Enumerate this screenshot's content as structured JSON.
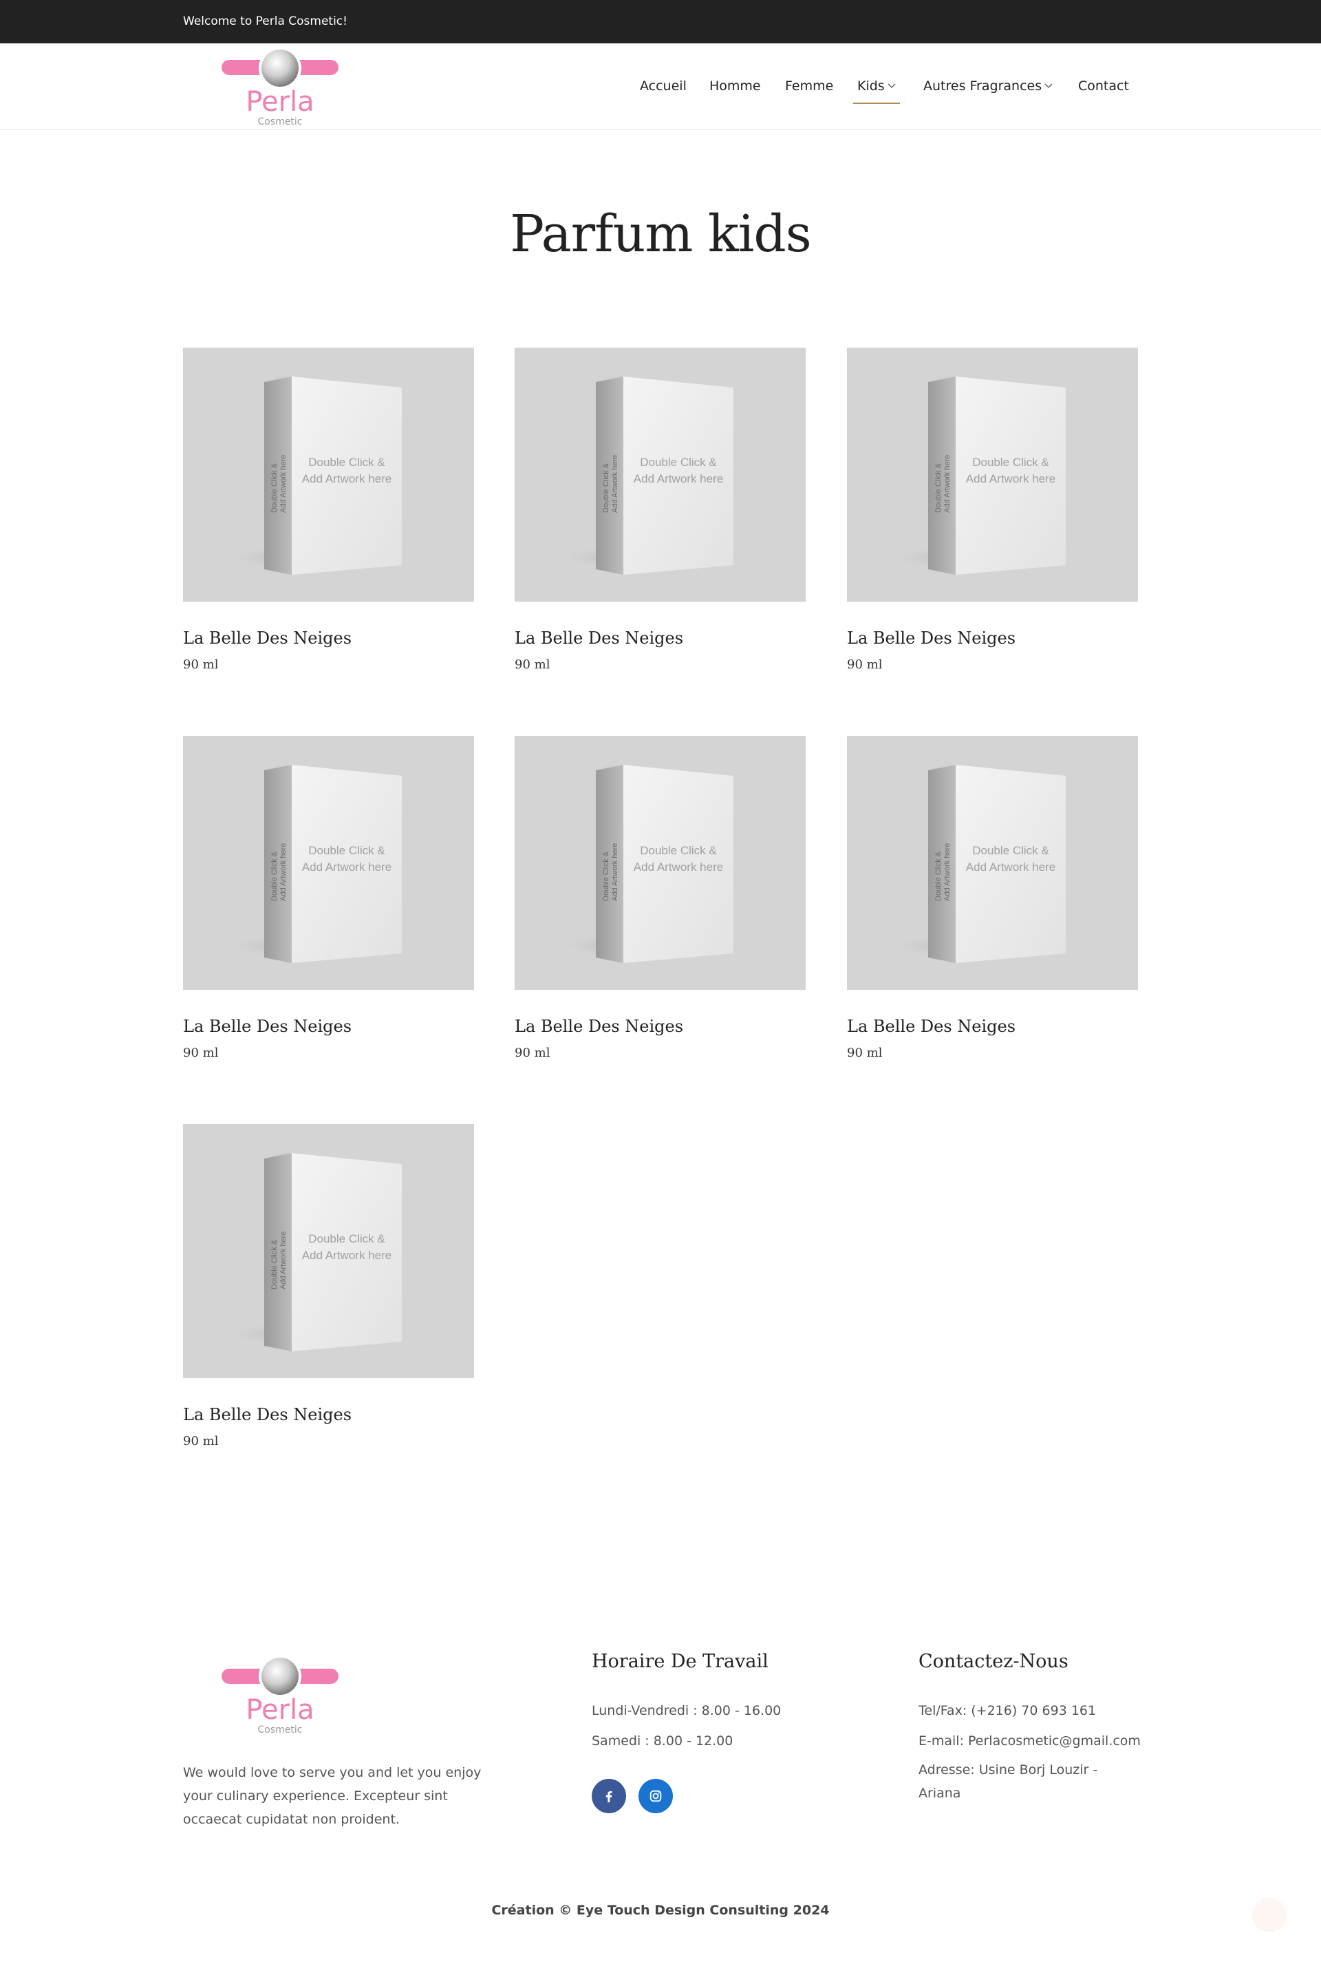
{
  "topbar": {
    "welcome": "Welcome to Perla Cosmetic!"
  },
  "brand": {
    "name": "Perla",
    "tagline": "Cosmetic",
    "accent": "#f07fb0"
  },
  "nav": {
    "items": [
      {
        "label": "Accueil",
        "has_dropdown": false,
        "active": false
      },
      {
        "label": "Homme",
        "has_dropdown": false,
        "active": false
      },
      {
        "label": "Femme",
        "has_dropdown": false,
        "active": false
      },
      {
        "label": "Kids",
        "has_dropdown": true,
        "active": true
      },
      {
        "label": "Autres Fragrances",
        "has_dropdown": true,
        "active": false
      },
      {
        "label": "Contact",
        "has_dropdown": false,
        "active": false
      }
    ],
    "active_color": "#b08d57"
  },
  "page": {
    "title": "Parfum kids"
  },
  "products": [
    {
      "name": "La Belle Des Neiges",
      "size": "90 ml"
    },
    {
      "name": "La Belle Des Neiges",
      "size": "90 ml"
    },
    {
      "name": "La Belle Des Neiges",
      "size": "90 ml"
    },
    {
      "name": "La Belle Des Neiges",
      "size": "90 ml"
    },
    {
      "name": "La Belle Des Neiges",
      "size": "90 ml"
    },
    {
      "name": "La Belle Des Neiges",
      "size": "90 ml"
    },
    {
      "name": "La Belle Des Neiges",
      "size": "90 ml"
    }
  ],
  "mockup": {
    "front_line1": "Double Click &",
    "front_line2": "Add Artwork here",
    "side_line1": "Double Click &",
    "side_line2": "Add Artwork here"
  },
  "footer": {
    "about": "We would love to serve you and let you enjoy your culinary experience. Excepteur sint occaecat cupidatat non proident.",
    "hours": {
      "title": "Horaire De Travail",
      "lines": [
        "Lundi-Vendredi : 8.00 - 16.00",
        "Samedi : 8.00 - 12.00"
      ]
    },
    "contact": {
      "title": "Contactez-Nous",
      "lines": [
        "Tel/Fax: (+216) 70 693 161",
        "E-mail: Perlacosmetic@gmail.com",
        "Adresse: Usine Borj Louzir - Ariana"
      ]
    },
    "social": [
      {
        "icon": "facebook-icon",
        "color": "#3b5998"
      },
      {
        "icon": "instagram-icon",
        "color": "#1a73d1"
      }
    ],
    "copyright": "Création © Eye Touch Design Consulting 2024"
  }
}
